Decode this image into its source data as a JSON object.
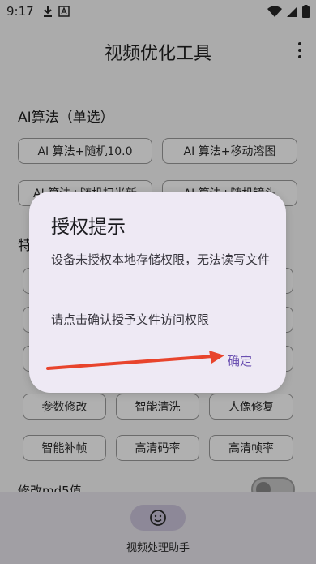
{
  "status_bar": {
    "time": "9:17"
  },
  "app_bar": {
    "title": "视频优化工具"
  },
  "ai_section": {
    "title": "AI算法（单选）",
    "chips": [
      "AI 算法+随机10.0",
      "AI 算法+移动溶图",
      "AI 算法+随机扫光新",
      "AI 算法+随机镜头"
    ]
  },
  "feature_section": {
    "title": "特",
    "chips_row1": [
      "参数修改",
      "智能清洗",
      "人像修复"
    ],
    "chips_row2": [
      "智能补帧",
      "高清码率",
      "高清帧率"
    ]
  },
  "md5": {
    "label": "修改md5值"
  },
  "dialog": {
    "title": "授权提示",
    "message": "设备未授权本地存储权限，无法读写文件",
    "message2": "请点击确认授予文件访问权限",
    "confirm": "确定"
  },
  "bottom_nav": {
    "label": "视频处理助手",
    "icon": "smiley-icon"
  },
  "colors": {
    "scrim": "#ababab",
    "dialog_bg": "#eee9f4",
    "accent": "#6a4fb1",
    "arrow": "#e8442c"
  }
}
